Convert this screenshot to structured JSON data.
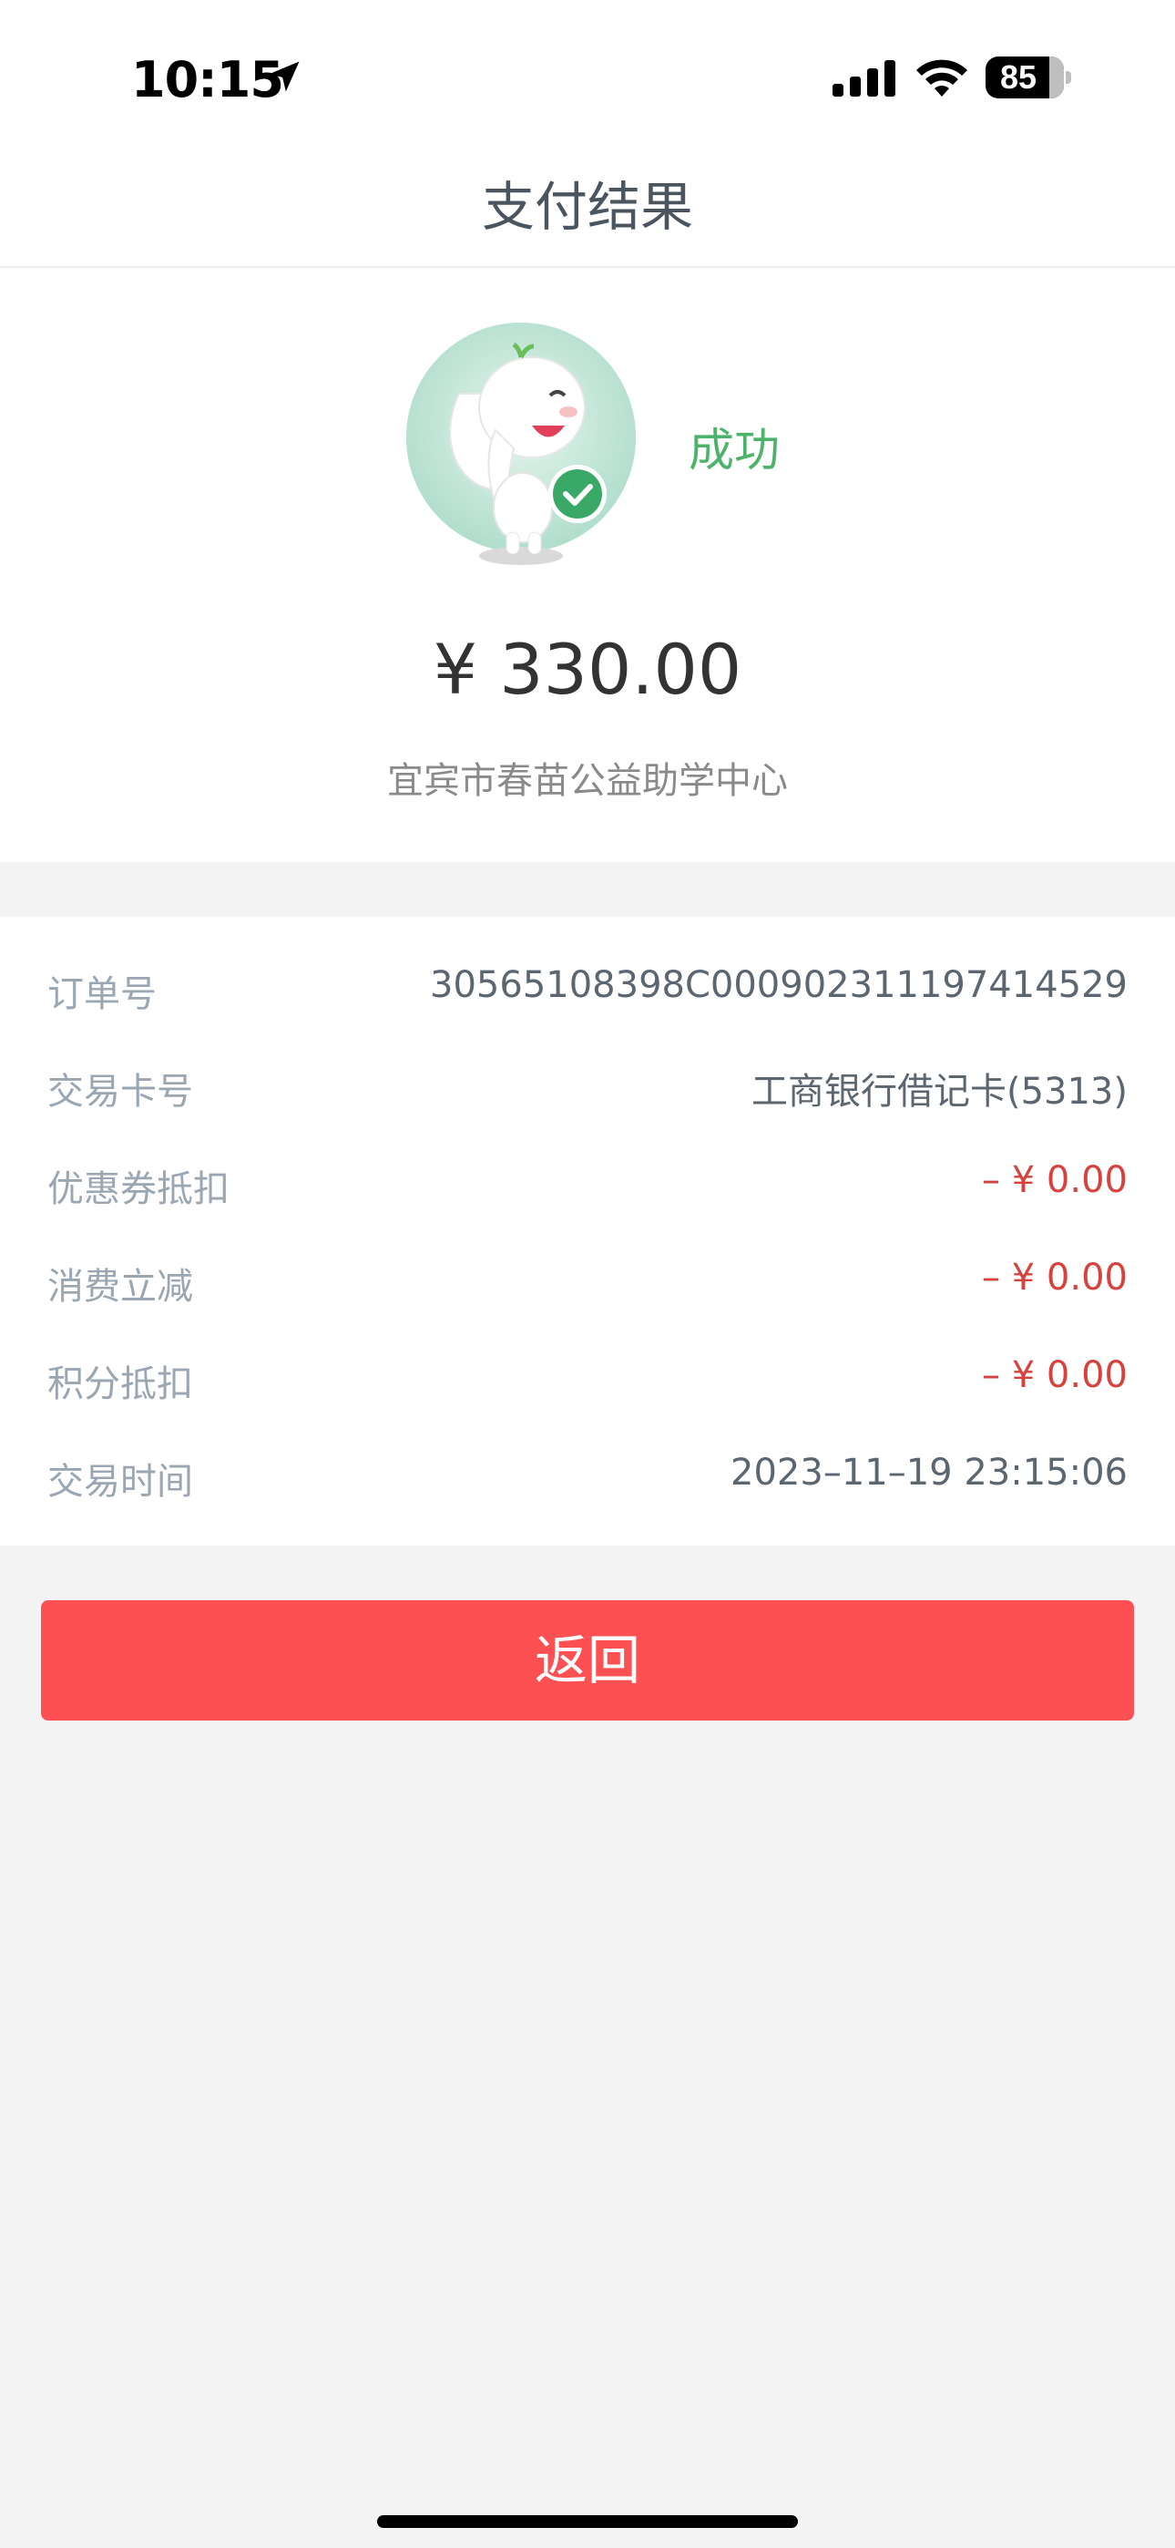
{
  "status_bar": {
    "time": "10:15",
    "battery": "85"
  },
  "nav": {
    "title": "支付结果"
  },
  "result": {
    "status": "成功",
    "amount": "¥ 330.00",
    "merchant": "宜宾市春苗公益助学中心"
  },
  "details": [
    {
      "label": "订单号",
      "value": "30565108398C000902311197414529"
    },
    {
      "label": "交易卡号",
      "value": "工商银行借记卡(5313)"
    },
    {
      "label": "优惠券抵扣",
      "value": "– ¥ 0.00"
    },
    {
      "label": "消费立减",
      "value": "– ¥ 0.00"
    },
    {
      "label": "积分抵扣",
      "value": "– ¥ 0.00"
    },
    {
      "label": "交易时间",
      "value": "2023–11–19 23:15:06"
    }
  ],
  "actions": {
    "back_label": "返回"
  },
  "colors": {
    "success": "#4db36a",
    "discount": "#d6423e",
    "primary_button": "#fd5052"
  },
  "icons": {
    "mascot": "elephant-success-icon",
    "location": "location-arrow-icon",
    "signal": "signal-icon",
    "wifi": "wifi-icon",
    "battery": "battery-icon"
  }
}
